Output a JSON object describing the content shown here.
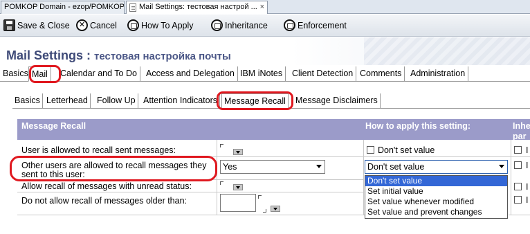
{
  "window_tabs": [
    {
      "label": "POMKOP Domain - ezop/POMKOP"
    },
    {
      "label": "Mail Settings: тестовая настрой ...",
      "close": "×"
    }
  ],
  "action_bar": {
    "save_close": "Save & Close",
    "cancel": "Cancel",
    "how_to_apply": "How To Apply",
    "inheritance": "Inheritance",
    "enforcement": "Enforcement"
  },
  "title": {
    "main": "Mail Settings",
    "separator": " : ",
    "sub": "тестовая настройка почты"
  },
  "main_tabs": [
    "Basics",
    "Mail",
    "Calendar and To Do",
    "Access and Delegation",
    "IBM iNotes",
    "Client Detection",
    "Comments",
    "Administration"
  ],
  "sub_tabs": [
    "Basics",
    "Letterhead",
    "Follow Up",
    "Attention Indicators",
    "Message Recall",
    "Message Disclaimers"
  ],
  "header": {
    "section": "Message Recall",
    "how_to_apply": "How to apply this setting:",
    "inherit": "Inhe\npar"
  },
  "rows": [
    {
      "label": "User is allowed to recall sent messages:",
      "how_to_apply_checkbox": "Don't set value"
    },
    {
      "label": "Other users are allowed to recall messages they\nsent to this user:",
      "value": "Yes",
      "how_to_apply_select": "Don't set value"
    },
    {
      "label": "Allow recall of messages with unread status:"
    },
    {
      "label": "Do not allow recall of messages older than:"
    }
  ],
  "dropdown_options": [
    "Don't set value",
    "Set initial value",
    "Set value whenever modified",
    "Set value and prevent changes"
  ],
  "inherit_checkbox_label": "I",
  "colors": {
    "header_band": "#9b9bc9",
    "title_text": "#3e4a78",
    "annotation_ring": "#e0181f",
    "selection": "#3367d6"
  }
}
